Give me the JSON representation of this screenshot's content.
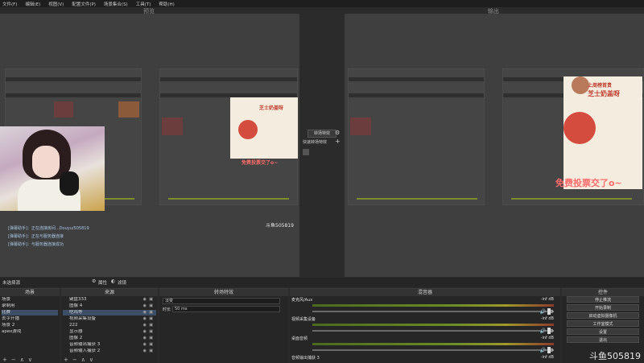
{
  "menu": [
    "文件(F)",
    "编辑(E)",
    "视图(V)",
    "配置文件(P)",
    "场景集合(S)",
    "工具(T)",
    "帮助(H)"
  ],
  "preview_label": "预览",
  "program_label": "输出",
  "chat_lines": [
    "[弹幕助手]：正在连接房间...Douyu/505819",
    "[弹幕助手]：正在与服务器连接",
    "[弹幕助手]：与服务器连接成功"
  ],
  "overlay": {
    "title": "上周榜首贵",
    "name": "芝士奶盖呀",
    "promo": "免费投票交了o~"
  },
  "watermark_small": "斗鱼505819",
  "watermark_big": "斗鱼505819",
  "transition_panel": {
    "transition_button": "转场特效",
    "quick_label": "快速转场特效",
    "plus": "+"
  },
  "status_left": "未选择源",
  "status_props": "属性",
  "status_filters": "滤镜",
  "docks": {
    "scenes_title": "场景",
    "sources_title": "来源",
    "transitions_title": "转场特效",
    "mixer_title": "混音器",
    "controls_title": "控件"
  },
  "scenes": [
    "场景",
    "录制用",
    "比赛",
    "去字开播",
    "场景 2",
    "apex游戏"
  ],
  "sources": [
    "键盘333",
    "图像 4",
    "吃鸡等",
    "视频采集设备",
    "222",
    "显示器",
    "图像 2",
    "音频输出捕获 3",
    "音频输入捕获 2"
  ],
  "transitions": {
    "type": "淡变",
    "duration_label": "时长",
    "duration_value": "50 ms"
  },
  "mixer": [
    {
      "name": "麦克风/Aux",
      "db": "-inf dB"
    },
    {
      "name": "视频采集设备",
      "db": "-inf dB"
    },
    {
      "name": "桌面音频",
      "db": "-inf dB"
    },
    {
      "name": "音频输出捕获 3",
      "db": "-inf dB"
    }
  ],
  "controls": [
    "停止推流",
    "开始录制",
    "启动虚拟摄像机",
    "工作室模式",
    "设置",
    "退出"
  ],
  "footer_symbols": [
    "+",
    "−",
    "∧",
    "∨"
  ]
}
